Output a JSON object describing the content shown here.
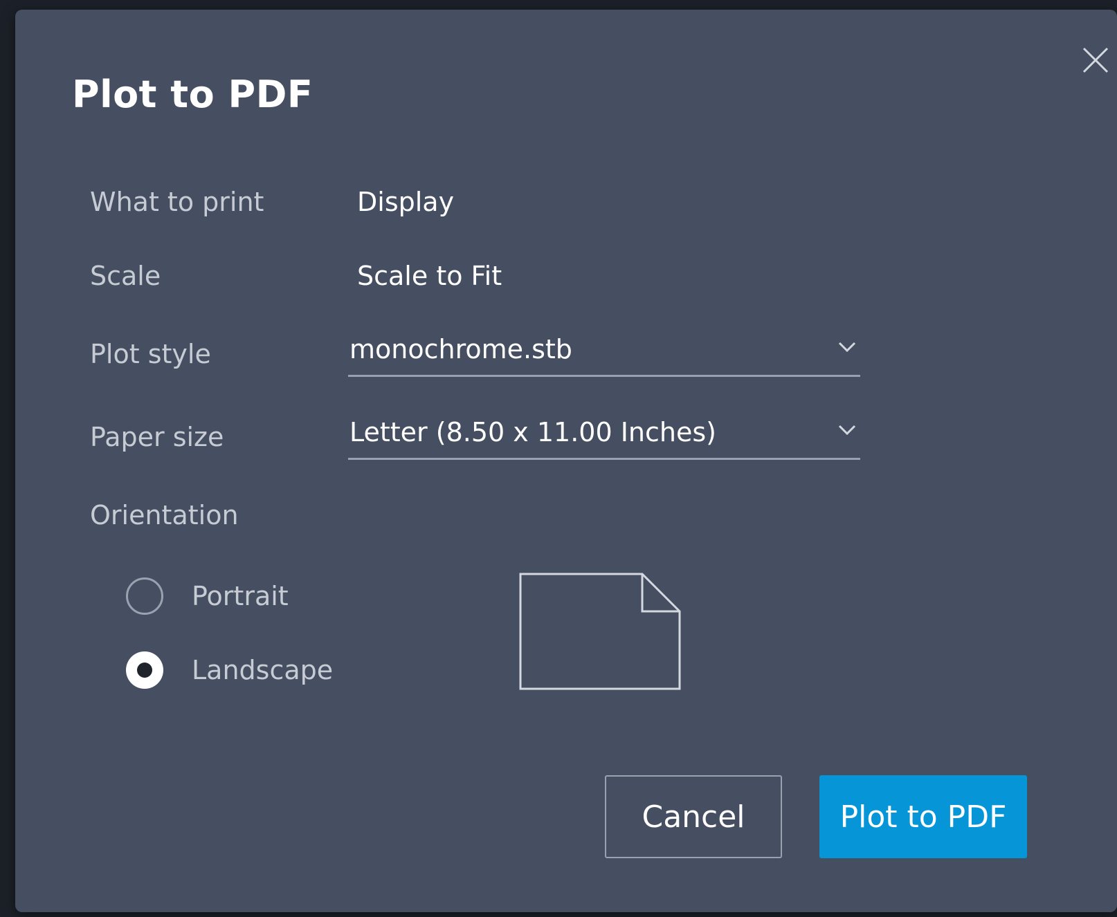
{
  "dialog": {
    "title": "Plot to PDF",
    "close_icon": "close-icon"
  },
  "fields": {
    "what_to_print": {
      "label": "What to print",
      "value": "Display"
    },
    "scale": {
      "label": "Scale",
      "value": "Scale to Fit"
    },
    "plot_style": {
      "label": "Plot style",
      "selected": "monochrome.stb",
      "icon": "chevron-down-icon"
    },
    "paper_size": {
      "label": "Paper size",
      "selected": "Letter (8.50 x 11.00 Inches)",
      "icon": "chevron-down-icon"
    }
  },
  "orientation": {
    "label": "Orientation",
    "options": [
      {
        "label": "Portrait",
        "selected": false
      },
      {
        "label": "Landscape",
        "selected": true
      }
    ],
    "preview_icon": "landscape-page-icon"
  },
  "buttons": {
    "cancel": "Cancel",
    "confirm": "Plot to PDF"
  },
  "colors": {
    "dialog_bg": "#464f61",
    "primary": "#0696d7",
    "label_text": "#c6cbd4",
    "value_text": "#ffffff"
  }
}
